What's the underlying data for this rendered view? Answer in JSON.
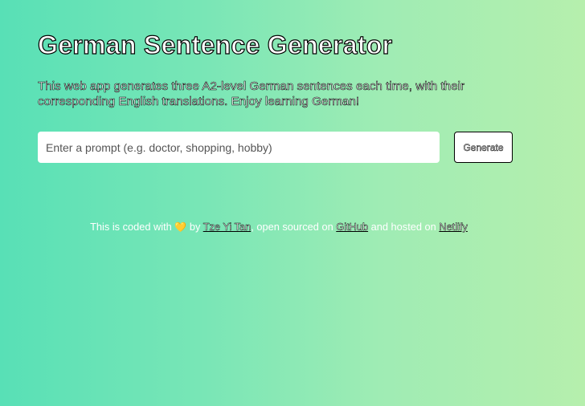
{
  "header": {
    "title": "German Sentence Generator",
    "description": "This web app generates three A2-level German sentences each time, with their corresponding English translations. Enjoy learning German!"
  },
  "form": {
    "prompt_placeholder": "Enter a prompt (e.g. doctor, shopping, hobby)",
    "prompt_value": "",
    "generate_label": "Generate"
  },
  "footer": {
    "text_before": "This is coded with ",
    "heart_glyph": "💛",
    "text_by": " by ",
    "author_link": "Tze Yi Tan",
    "text_open_sourced": ", open sourced on ",
    "github_link": "GitHub",
    "text_hosted": " and hosted on ",
    "netlify_link": "Netlify"
  },
  "colors": {
    "background_start": "#58e0b6",
    "background_end": "#b6efad",
    "heart": "#f4c542"
  }
}
